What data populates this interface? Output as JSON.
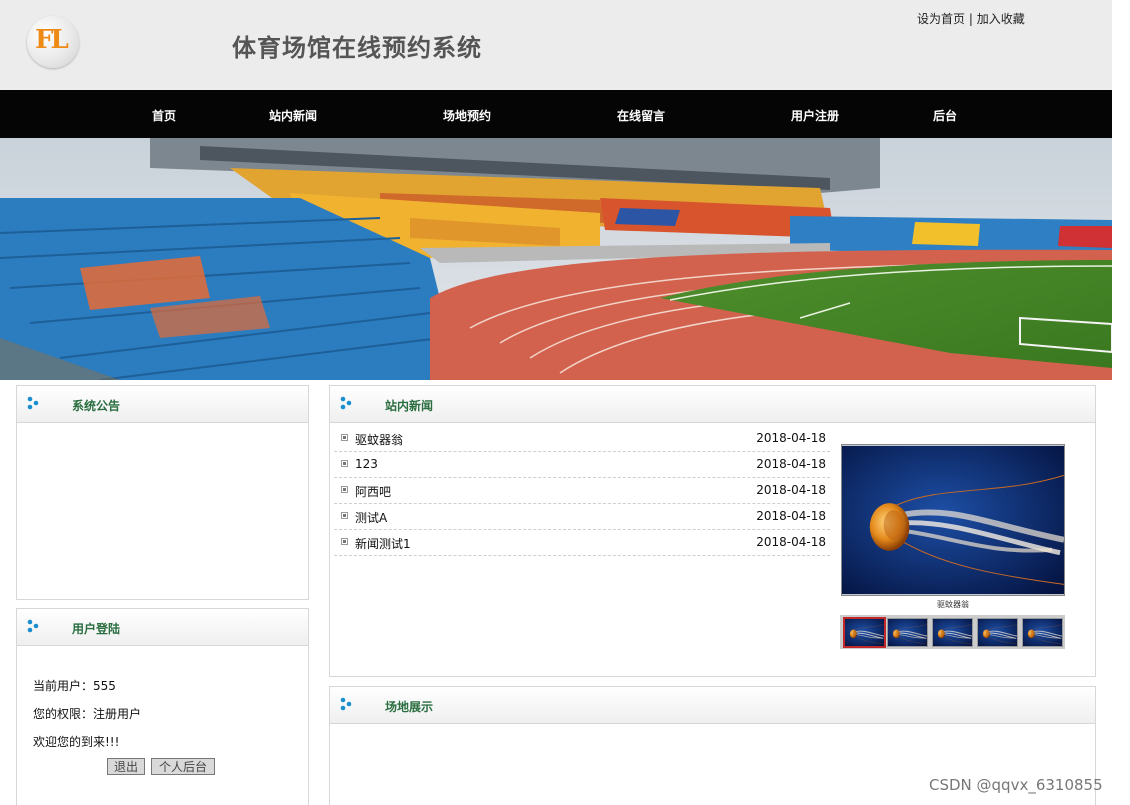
{
  "header": {
    "logo_text": "FL",
    "site_title": "体育场馆在线预约系统",
    "top_links": [
      "设为首页",
      "加入收藏"
    ],
    "top_links_separator": "|"
  },
  "nav": {
    "items": [
      "首页",
      "站内新闻",
      "场地预约",
      "在线留言",
      "用户注册",
      "后台"
    ]
  },
  "banner": {
    "icon": "stadium-image"
  },
  "notice_panel": {
    "title": "系统公告"
  },
  "login_panel": {
    "title": "用户登陆",
    "current_user_line": "当前用户：555",
    "permission_line": "您的权限：注册用户",
    "welcome_line": "欢迎您的到来!!!",
    "logout_button": "退出",
    "backend_button": "个人后台"
  },
  "news_panel": {
    "title": "站内新闻",
    "items": [
      {
        "title": "驱蚊器翁",
        "date": "2018-04-18"
      },
      {
        "title": "123",
        "date": "2018-04-18"
      },
      {
        "title": "阿西吧",
        "date": "2018-04-18"
      },
      {
        "title": "测试A",
        "date": "2018-04-18"
      },
      {
        "title": "新闻测试1",
        "date": "2018-04-18"
      }
    ],
    "slideshow": {
      "caption": "驱蚊器翁",
      "thumbnail_count": 5,
      "active_thumbnail": 1
    }
  },
  "venue_panel": {
    "title": "场地展示"
  },
  "watermark": "CSDN @qqvx_6310855",
  "colors": {
    "header_bg": "#ececec",
    "nav_bg": "#050505",
    "panel_title": "#2a6e40",
    "panel_border": "#d7d7d7",
    "active_thumb_border": "#c0282a"
  }
}
